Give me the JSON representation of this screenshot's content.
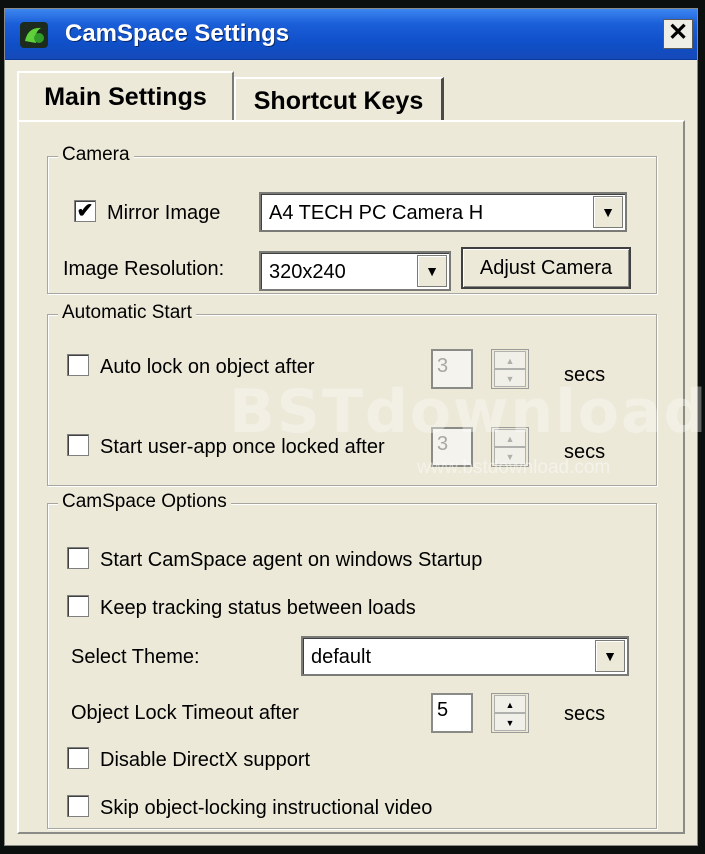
{
  "window": {
    "title": "CamSpace Settings",
    "close_label": "✕"
  },
  "tabs": [
    {
      "label": "Main Settings",
      "active": true
    },
    {
      "label": "Shortcut Keys",
      "active": false
    }
  ],
  "camera": {
    "group_title": "Camera",
    "mirror_label": "Mirror Image",
    "mirror_checked": "✔",
    "device_value": "A4 TECH PC Camera H",
    "resolution_label": "Image Resolution:",
    "resolution_value": "320x240",
    "adjust_button": "Adjust Camera"
  },
  "automatic_start": {
    "group_title": "Automatic Start",
    "auto_lock_label": "Auto lock on object after",
    "auto_lock_value": "3",
    "auto_lock_unit": "secs",
    "start_app_label": "Start user-app once locked after",
    "start_app_value": "3",
    "start_app_unit": "secs"
  },
  "options": {
    "group_title": "CamSpace Options",
    "agent_startup_label": "Start CamSpace agent on windows Startup",
    "keep_tracking_label": "Keep tracking status between loads",
    "theme_label": "Select Theme:",
    "theme_value": "default",
    "timeout_label": "Object Lock Timeout after",
    "timeout_value": "5",
    "timeout_unit": "secs",
    "directx_label": "Disable DirectX support",
    "skip_video_label": "Skip object-locking instructional video"
  },
  "watermark": {
    "main": "BSTdownload",
    "url": "www.bstdownload.com"
  },
  "icons": {
    "app": "camspace-logo-icon",
    "dropdown": "chevron-down-icon",
    "spin_up": "spin-up-icon",
    "spin_down": "spin-down-icon"
  },
  "colors": {
    "titlebar": "#1a5ed8",
    "window_bg": "#ece9d8"
  }
}
